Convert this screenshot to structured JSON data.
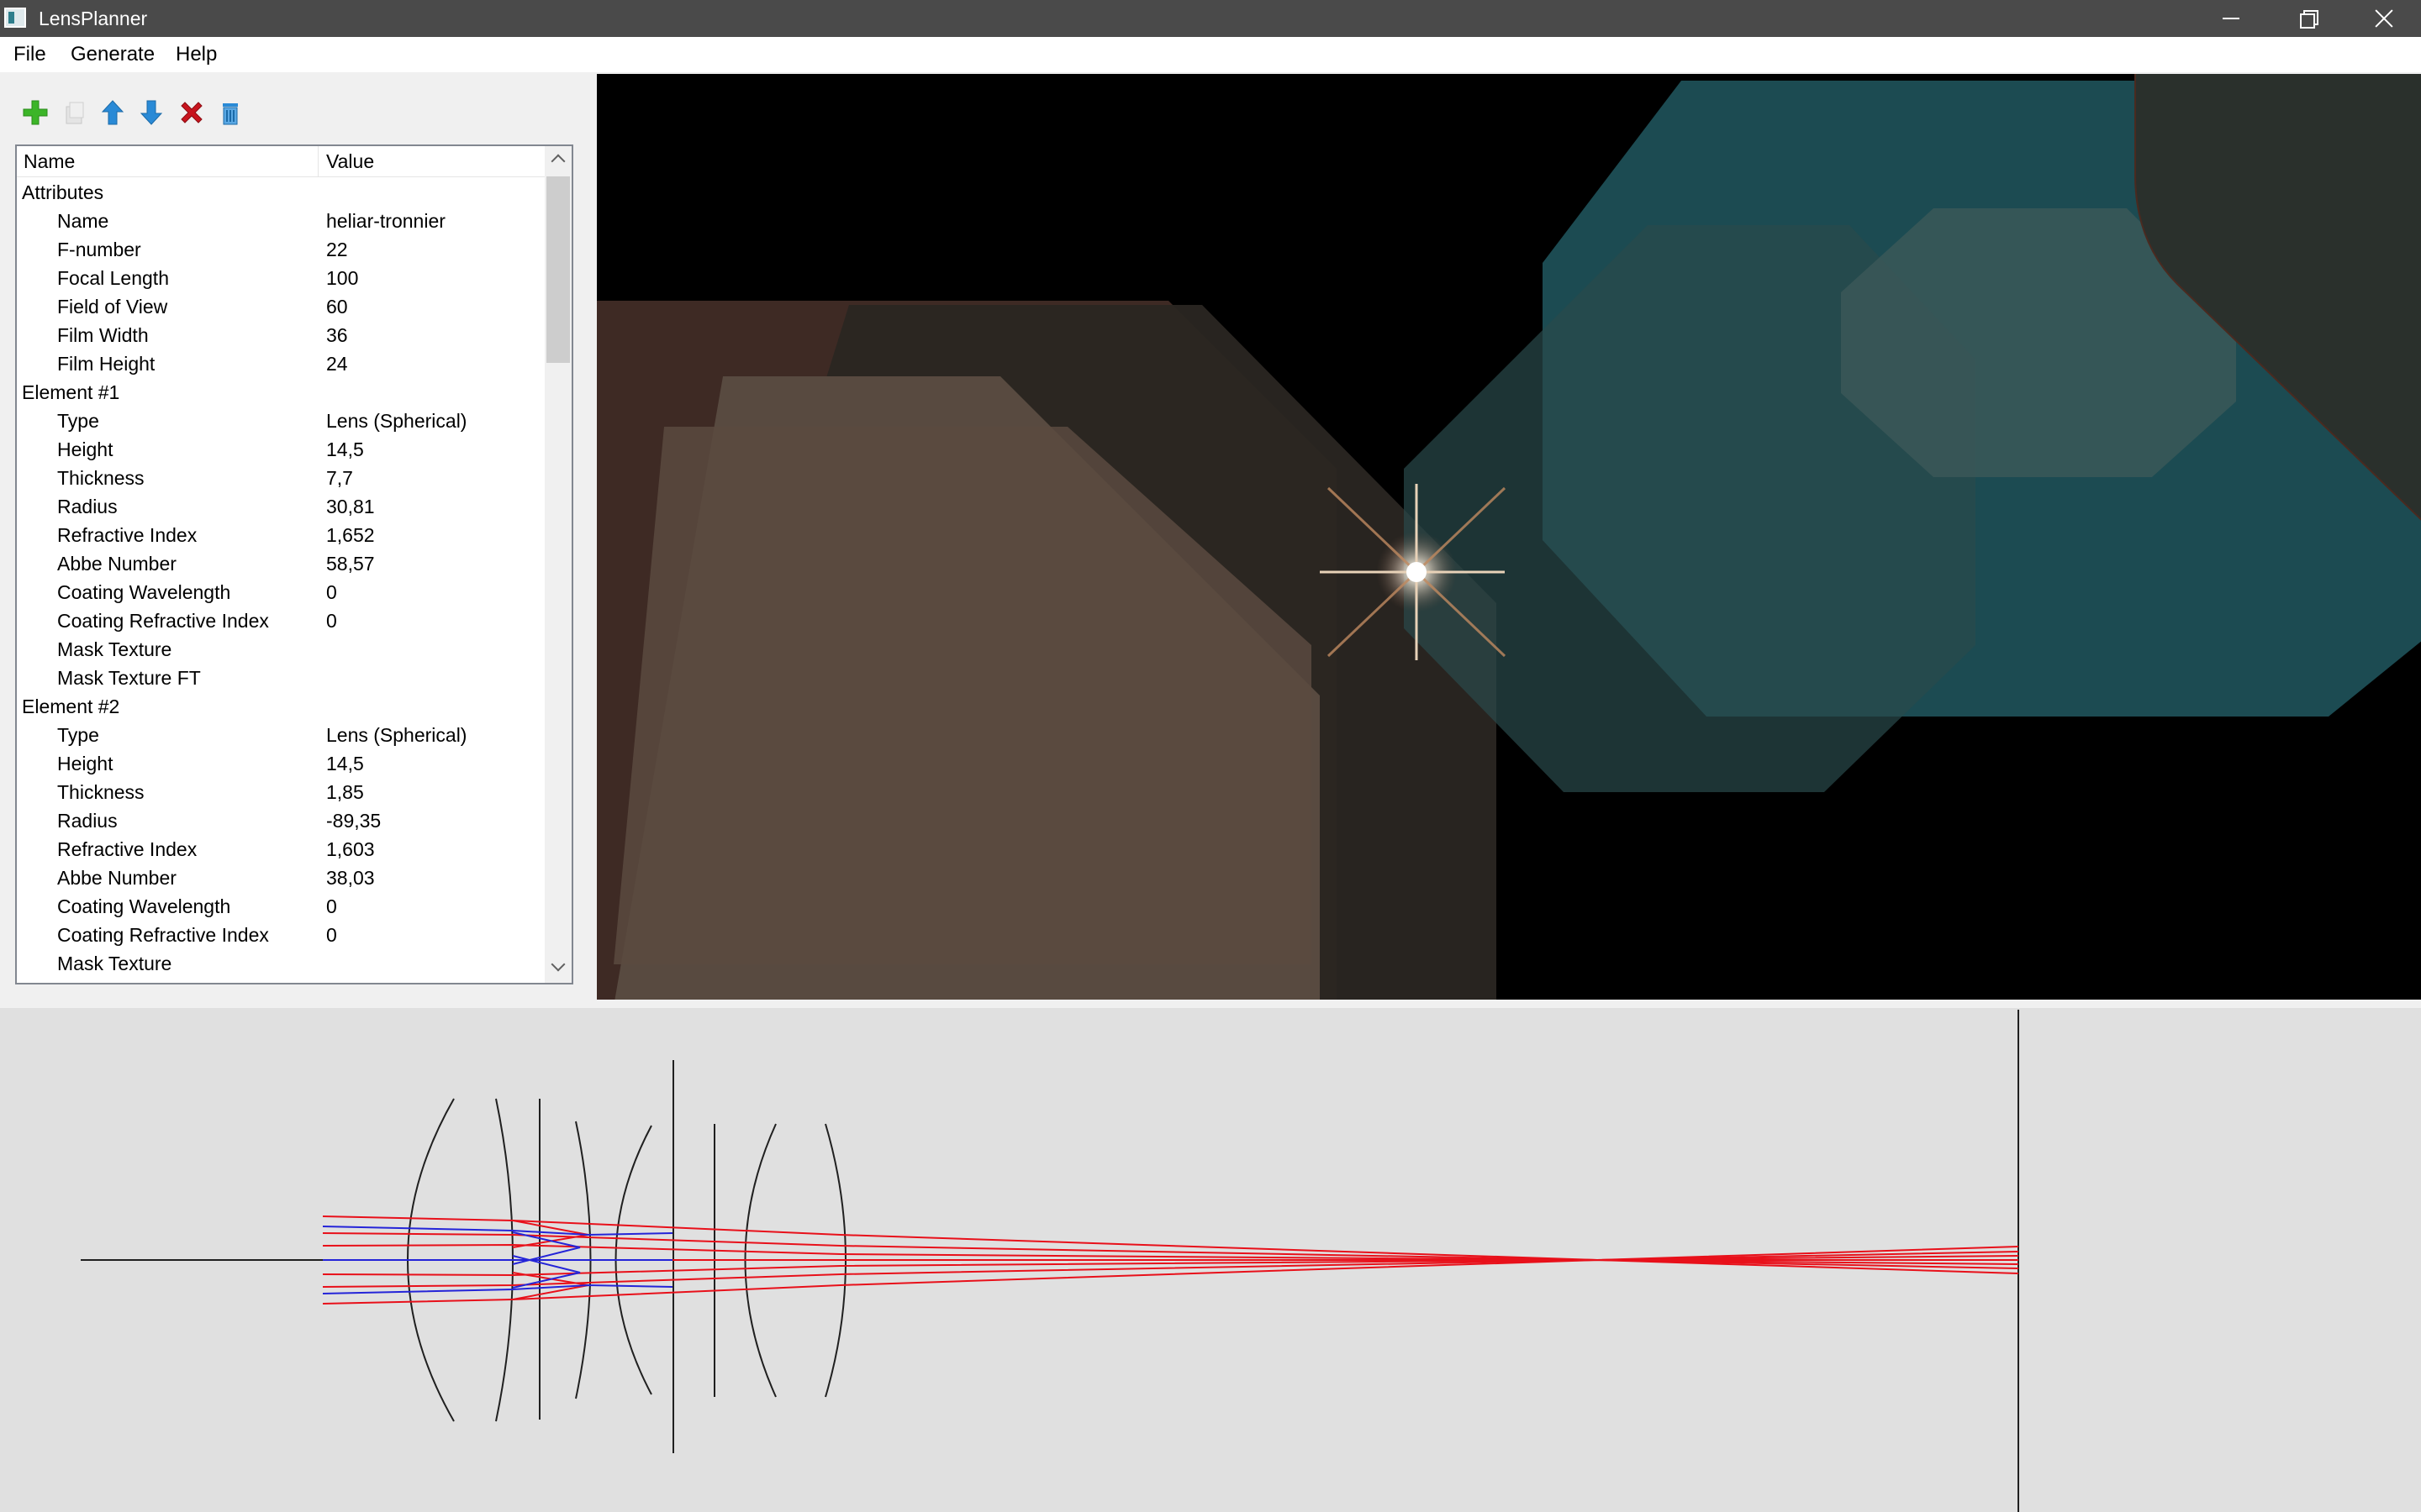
{
  "window": {
    "title": "LensPlanner"
  },
  "menu": {
    "file": "File",
    "generate": "Generate",
    "help": "Help"
  },
  "toolbar": {
    "add_icon": "add-icon",
    "copy_icon": "copy-icon",
    "move_up_icon": "arrow-up-icon",
    "move_down_icon": "arrow-down-icon",
    "remove_icon": "remove-icon",
    "clear_icon": "trash-icon"
  },
  "tree": {
    "headers": {
      "name": "Name",
      "value": "Value"
    },
    "groups": [
      {
        "label": "Attributes",
        "rows": [
          {
            "name": "Name",
            "value": "heliar-tronnier"
          },
          {
            "name": "F-number",
            "value": "22"
          },
          {
            "name": "Focal Length",
            "value": "100"
          },
          {
            "name": "Field of View",
            "value": "60"
          },
          {
            "name": "Film Width",
            "value": "36"
          },
          {
            "name": "Film Height",
            "value": "24"
          }
        ]
      },
      {
        "label": "Element #1",
        "rows": [
          {
            "name": "Type",
            "value": "Lens (Spherical)"
          },
          {
            "name": "Height",
            "value": "14,5"
          },
          {
            "name": "Thickness",
            "value": "7,7"
          },
          {
            "name": "Radius",
            "value": "30,81"
          },
          {
            "name": "Refractive Index",
            "value": "1,652"
          },
          {
            "name": "Abbe Number",
            "value": "58,57"
          },
          {
            "name": "Coating Wavelength",
            "value": "0"
          },
          {
            "name": "Coating Refractive Index",
            "value": "0"
          },
          {
            "name": "Mask Texture",
            "value": ""
          },
          {
            "name": "Mask Texture FT",
            "value": ""
          }
        ]
      },
      {
        "label": "Element #2",
        "rows": [
          {
            "name": "Type",
            "value": "Lens (Spherical)"
          },
          {
            "name": "Height",
            "value": "14,5"
          },
          {
            "name": "Thickness",
            "value": "1,85"
          },
          {
            "name": "Radius",
            "value": "-89,35"
          },
          {
            "name": "Refractive Index",
            "value": "1,603"
          },
          {
            "name": "Abbe Number",
            "value": "38,03"
          },
          {
            "name": "Coating Wavelength",
            "value": "0"
          },
          {
            "name": "Coating Refractive Index",
            "value": "0"
          },
          {
            "name": "Mask Texture",
            "value": ""
          }
        ]
      }
    ]
  },
  "colors": {
    "ray_red": "#e8101a",
    "ray_blue": "#2424d8",
    "lens_line": "#202020",
    "flare_teal": "#1e4a52",
    "flare_brown": "#52443c"
  }
}
